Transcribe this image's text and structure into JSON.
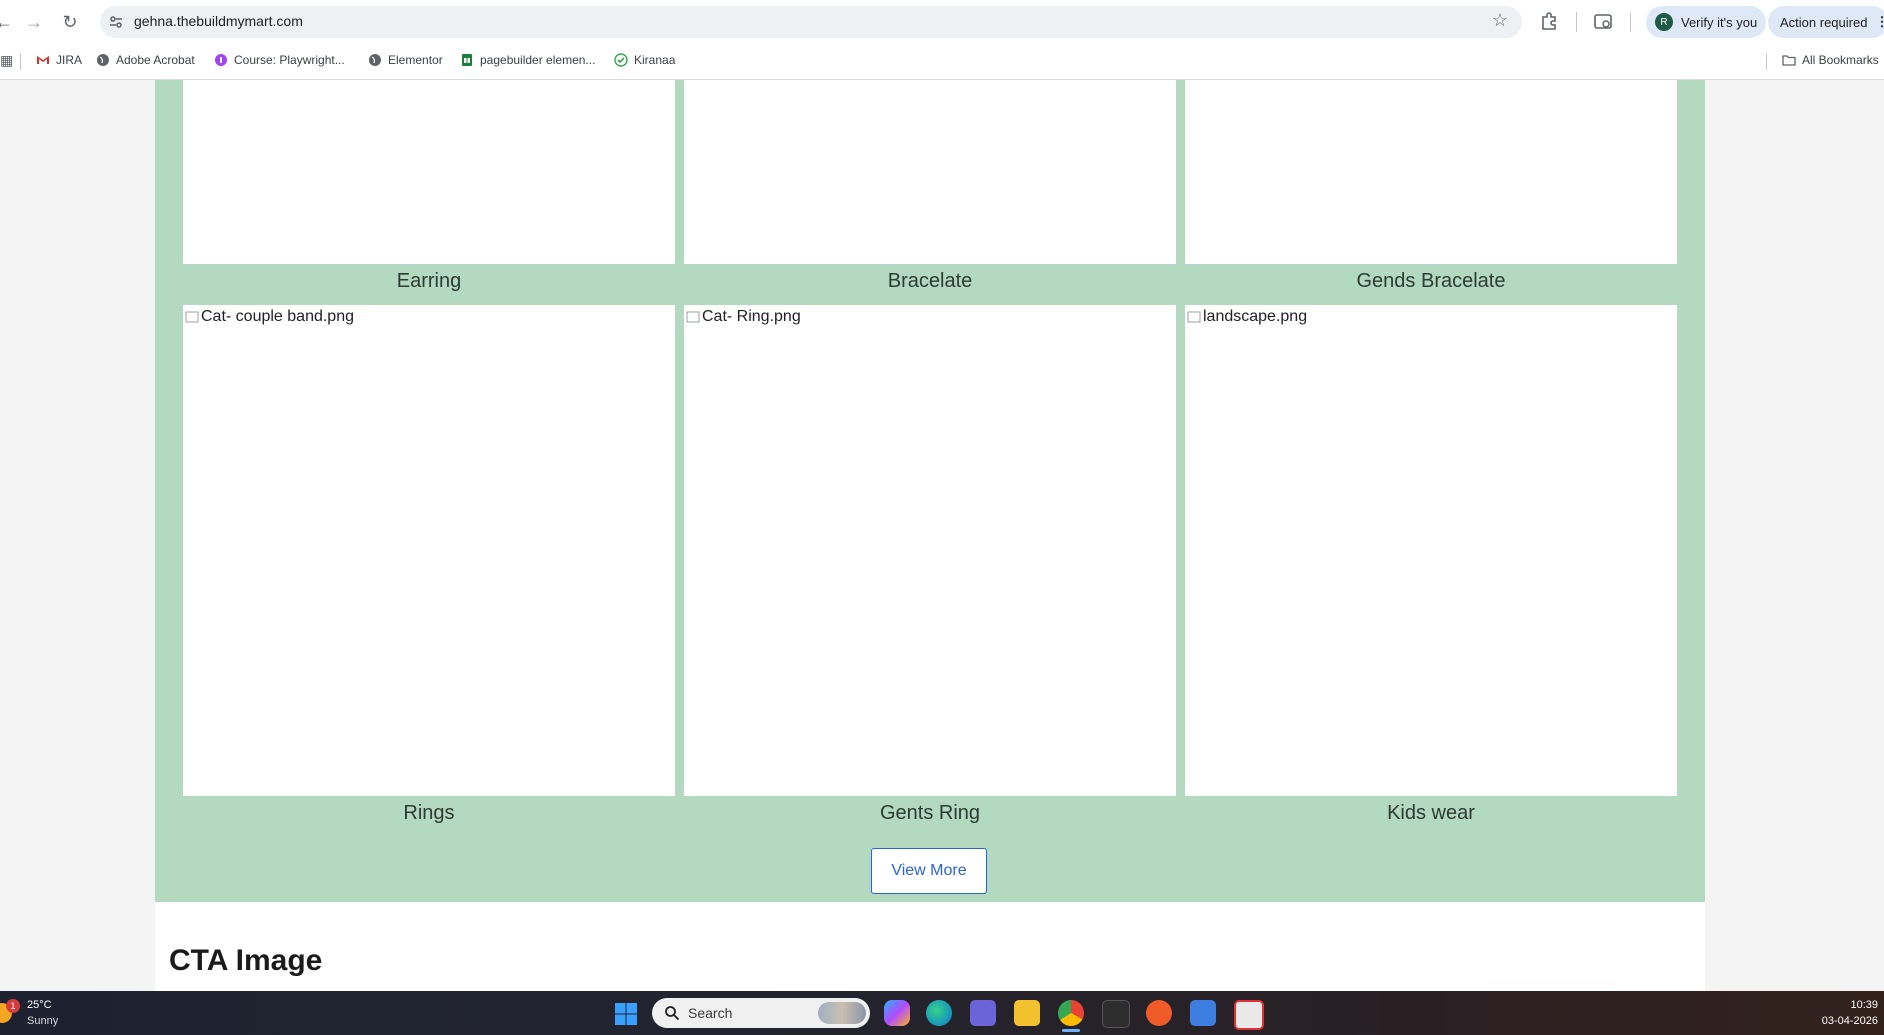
{
  "browser": {
    "url": "gehna.thebuildmymart.com",
    "profile_initial": "R",
    "verify_label": "Verify it's you",
    "action_label": "Action required",
    "bookmarks": [
      {
        "label": "JIRA",
        "icon": "gmail-icon"
      },
      {
        "label": "Adobe Acrobat",
        "icon": "globe-icon"
      },
      {
        "label": "Course: Playwright...",
        "icon": "course-icon"
      },
      {
        "label": "Elementor",
        "icon": "globe-icon"
      },
      {
        "label": "pagebuilder elemen...",
        "icon": "sheets-icon"
      },
      {
        "label": "Kiranaa",
        "icon": "check-icon"
      }
    ],
    "all_bookmarks_label": "All Bookmarks"
  },
  "categories": {
    "row1": [
      {
        "label": "Earring"
      },
      {
        "label": "Bracelate"
      },
      {
        "label": "Gends Bracelate"
      }
    ],
    "row2": [
      {
        "alt": "Cat- couple band.png",
        "label": "Rings"
      },
      {
        "alt": "Cat- Ring.png",
        "label": "Gents Ring"
      },
      {
        "alt": "landscape.png",
        "label": "Kids wear"
      }
    ],
    "view_more_label": "View More"
  },
  "cta": {
    "title": "CTA Image"
  },
  "taskbar": {
    "weather_temp": "25°C",
    "weather_condition": "Sunny",
    "weather_badge": "1",
    "search_placeholder": "Search",
    "time": "10:39",
    "date": "03-04-2026"
  },
  "colors": {
    "section_bg": "#b3d9c0",
    "accent_button": "#2a64d8"
  }
}
